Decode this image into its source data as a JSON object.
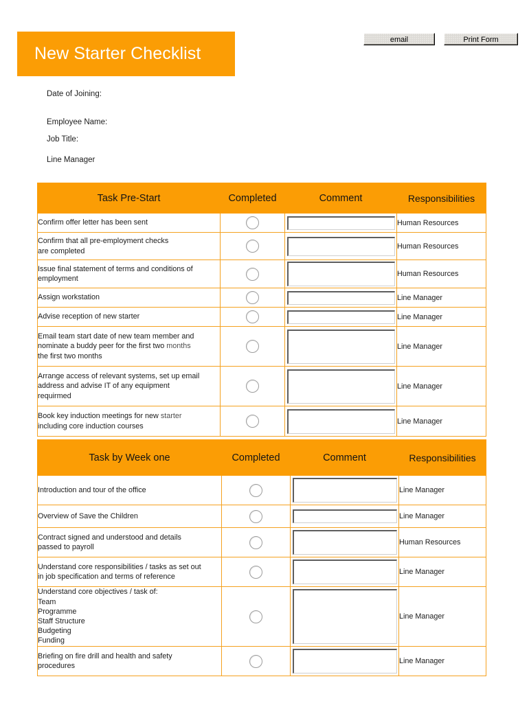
{
  "toolbar": {
    "email_label": "email",
    "print_label": "Print Form"
  },
  "header": {
    "title": "New Starter Checklist",
    "banner_color": "#FB9D05"
  },
  "meta": {
    "date_of_joining_label": "Date of Joining:",
    "employee_name_label": "Employee Name:",
    "job_title_label": "Job Title:",
    "line_manager_label": "Line Manager"
  },
  "tables": [
    {
      "id": "prestart",
      "columns": [
        "Task Pre-Start",
        "Completed",
        "Comment",
        "Responsibilities"
      ],
      "rows": [
        {
          "task": "Confirm offer letter has been sent",
          "comment": "",
          "responsibility": "Human Resources"
        },
        {
          "task": "Confirm that all pre-employment checks\nare completed",
          "comment": "",
          "responsibility": "Human Resources"
        },
        {
          "task": "Issue final statement of terms and conditions of\nemployment",
          "comment": "",
          "responsibility": "Human Resources"
        },
        {
          "task": "Assign workstation",
          "comment": "",
          "responsibility": "Line Manager"
        },
        {
          "task": "Advise reception of new starter",
          "comment": "",
          "responsibility": "Line Manager"
        },
        {
          "task": "Email team start date of new team member and\nnominate a buddy peer for the first two  months\nthe first two months",
          "comment": "",
          "responsibility": "Line Manager"
        },
        {
          "task": "Arrange access of relevant systems, set up email\naddress and advise IT of any equipment\nrequirmed",
          "comment": "",
          "responsibility": "Line Manager"
        },
        {
          "task": "Book key induction meetings for new  starter\nincluding core induction courses",
          "comment": "",
          "responsibility": "Line Manager"
        }
      ]
    },
    {
      "id": "week1",
      "columns": [
        "Task by Week one",
        "Completed",
        "Comment",
        "Responsibilities"
      ],
      "rows": [
        {
          "task": "Introduction and tour of the office",
          "comment": "",
          "responsibility": "Line Manager"
        },
        {
          "task": "Overview of Save the Children",
          "comment": "",
          "responsibility": "Line Manager"
        },
        {
          "task": "Contract signed and understood and details\npassed to payroll",
          "comment": "",
          "responsibility": "Human Resources"
        },
        {
          "task": "Understand core responsibilities / tasks as set out\nin job specification and terms of reference",
          "comment": "",
          "responsibility": "Line Manager"
        },
        {
          "task": "Understand core objectives / task of:\nTeam\nProgramme\nStaff Structure\nBudgeting\nFunding",
          "comment": "",
          "responsibility": "Line Manager"
        },
        {
          "task": "Briefing on fire drill and health and safety\nprocedures",
          "comment": "",
          "responsibility": "Line Manager"
        }
      ]
    }
  ]
}
